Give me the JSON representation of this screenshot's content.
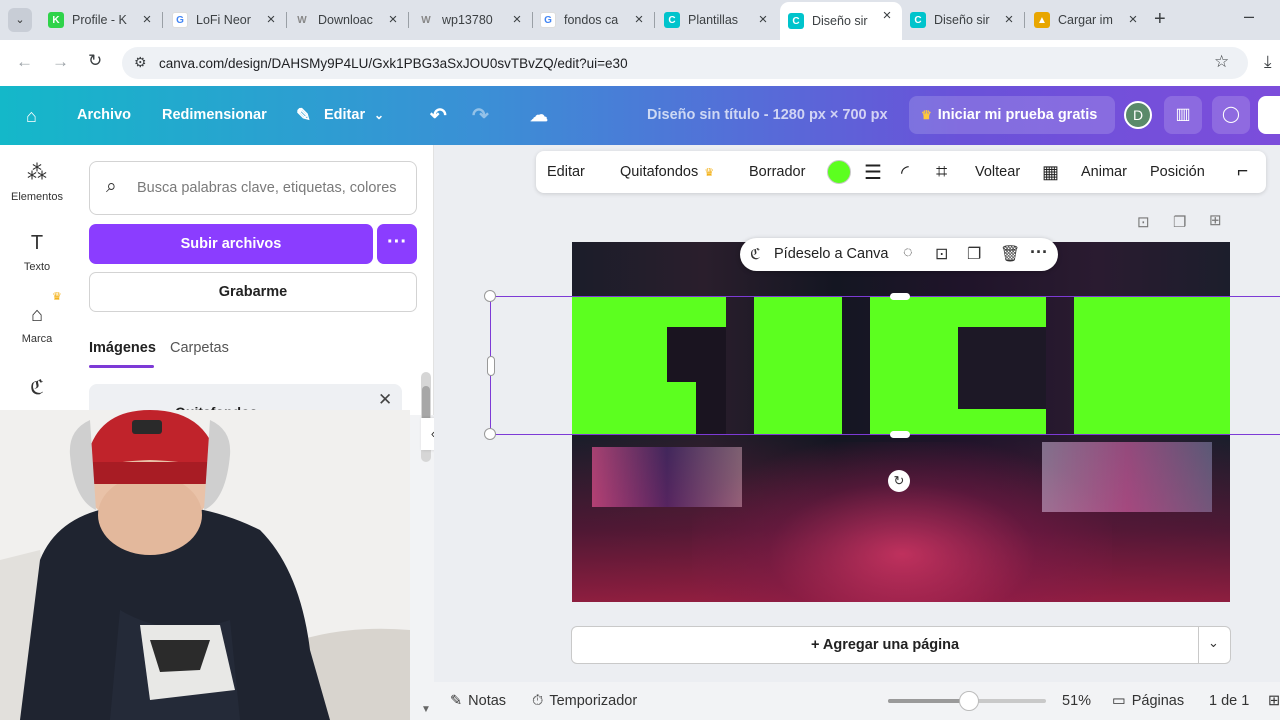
{
  "tabs": [
    {
      "label": "Profile - K",
      "icon": "kick-icon",
      "color": "#2fd34a"
    },
    {
      "label": "LoFi Neor",
      "icon": "google-icon",
      "color": "#4285f4"
    },
    {
      "label": "Downloac",
      "icon": "wallpaper-icon",
      "color": "#888888"
    },
    {
      "label": "wp13780",
      "icon": "wallpaper-icon",
      "color": "#888888"
    },
    {
      "label": "fondos ca",
      "icon": "google-icon",
      "color": "#4285f4"
    },
    {
      "label": "Plantillas",
      "icon": "canva-icon",
      "color": "#00c4cc"
    },
    {
      "label": "Diseño sir",
      "icon": "canva-icon",
      "color": "#00c4cc"
    },
    {
      "label": "Diseño sir",
      "icon": "canva-icon",
      "color": "#00c4cc"
    },
    {
      "label": "Cargar im",
      "icon": "hat-icon",
      "color": "#e8a600"
    }
  ],
  "address": {
    "url": "canva.com/design/DAHSMy9P4LU/Gxk1PBG3aSxJOU0svTBvZQ/edit?ui=e30"
  },
  "header": {
    "archivo": "Archivo",
    "redimensionar": "Redimensionar",
    "editar": "Editar",
    "title": "Diseño sin título - 1280 px × 700 px",
    "trial": "Iniciar mi prueba gratis",
    "avatar": "D"
  },
  "rail": {
    "elementos": "Elementos",
    "texto": "Texto",
    "marca": "Marca"
  },
  "panel": {
    "search_placeholder": "Busca palabras clave, etiquetas, colores",
    "upload": "Subir archivos",
    "record": "Grabarme",
    "tab_images": "Imágenes",
    "tab_folders": "Carpetas",
    "card_title": "Quitafondos"
  },
  "toolbar": {
    "editar": "Editar",
    "quitafondos": "Quitafondos",
    "borrador": "Borrador",
    "voltear": "Voltear",
    "animar": "Animar",
    "posicion": "Posición",
    "color": "#5cff1f"
  },
  "floatbar": {
    "ask": "Pídeselo a Canva"
  },
  "addpage": {
    "label": "+ Agregar una página"
  },
  "footer": {
    "notas": "Notas",
    "temporizador": "Temporizador",
    "zoom": "51%",
    "zoom_level": 0.51,
    "paginas": "Páginas",
    "page_count": "1 de 1"
  },
  "colors": {
    "accent": "#7d3ad6",
    "green": "#5cff1f",
    "upload": "#8b3dff"
  }
}
